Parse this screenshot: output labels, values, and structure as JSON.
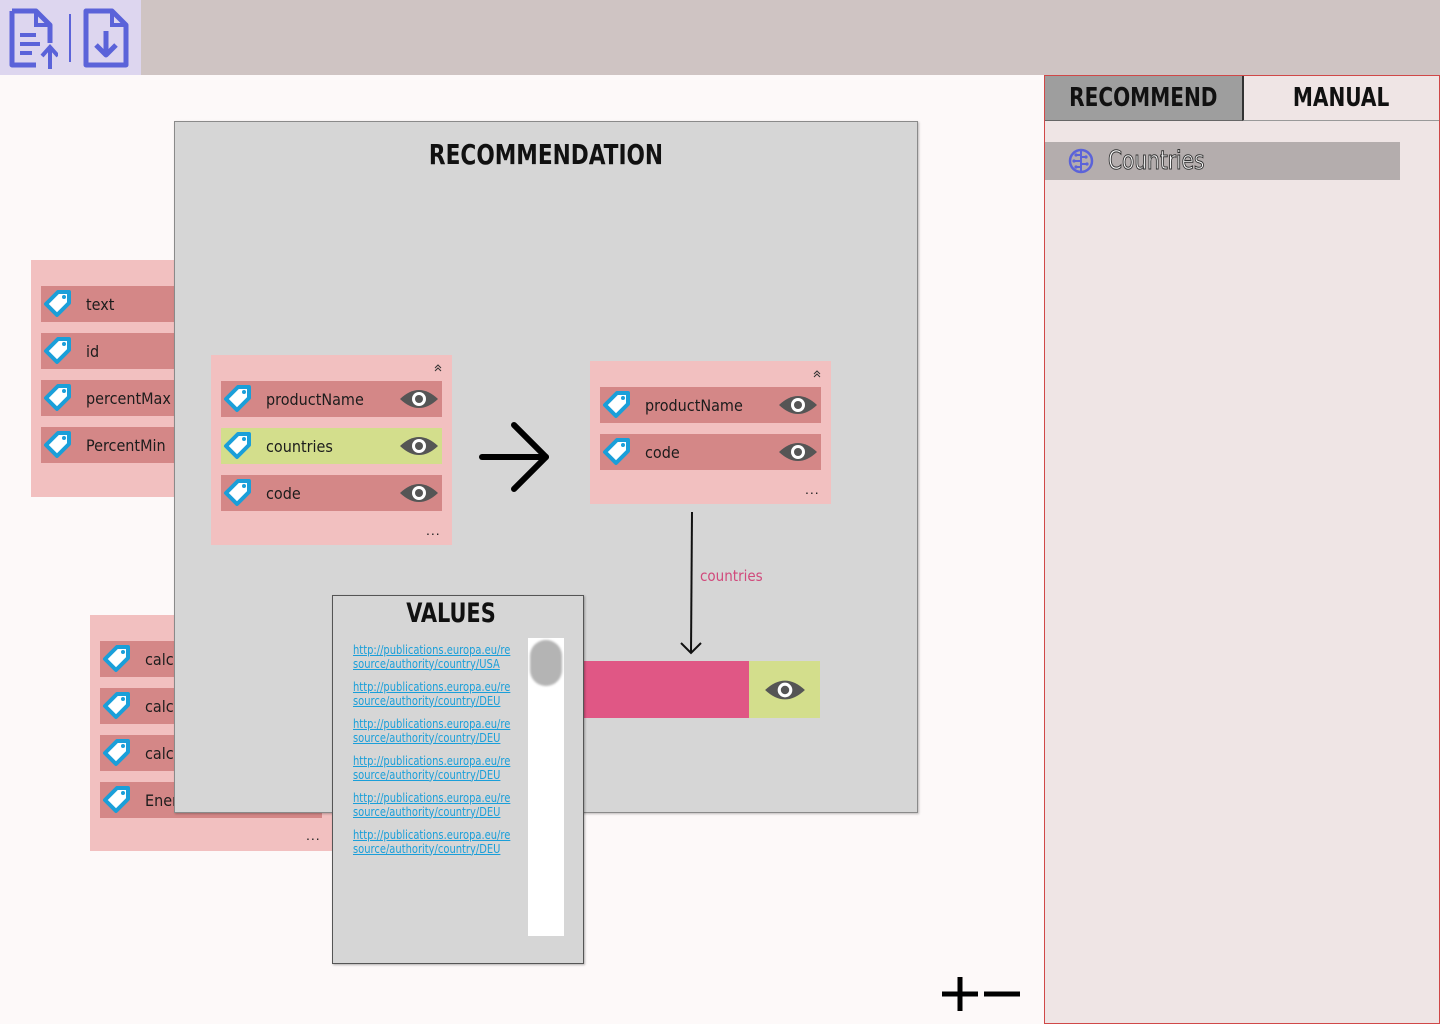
{
  "colors": {
    "topbar": "#cfc4c3",
    "toolbar_group": "#ddd6ef",
    "icon_accent": "#5b63d9",
    "card_bg": "#f2c0c0",
    "row_bg": "#d48787",
    "row_highlight": "#d3de8c",
    "tag_blue": "#1a9fd9",
    "eye_dark": "#555555",
    "panel_gray": "#d6d6d6",
    "target_pink": "#e05785",
    "link_blue": "#1a9fd9",
    "sidebar_bg": "#efe5e5",
    "sidebar_border": "#d04848"
  },
  "toolbar": {
    "upload_icon": "file-upload-icon",
    "download_icon": "file-download-icon"
  },
  "left_card_top": {
    "rows": [
      {
        "label": "text",
        "icon": "tag-icon"
      },
      {
        "label": "id",
        "icon": "tag-icon"
      },
      {
        "label": "percentMax",
        "icon": "tag-icon"
      },
      {
        "label": "PercentMin",
        "icon": "tag-icon"
      }
    ]
  },
  "left_card_bottom": {
    "rows": [
      {
        "label": "calci",
        "icon": "tag-icon"
      },
      {
        "label": "calci",
        "icon": "tag-icon"
      },
      {
        "label": "calci",
        "icon": "tag-icon"
      },
      {
        "label": "Ener",
        "icon": "tag-icon"
      }
    ],
    "more": "..."
  },
  "recommendation": {
    "title": "RECOMMENDATION",
    "source_card": {
      "rows": [
        {
          "label": "productName",
          "highlighted": false
        },
        {
          "label": "countries",
          "highlighted": true
        },
        {
          "label": "code",
          "highlighted": false
        }
      ],
      "more": "..."
    },
    "target_card": {
      "rows": [
        {
          "label": "productName"
        },
        {
          "label": "code"
        }
      ],
      "more": "..."
    },
    "arrow_icon": "arrow-right-icon",
    "flow_label": "countries"
  },
  "values": {
    "title": "VALUES",
    "items": [
      "http://publications.europa.eu/resource/authority/country/USA",
      "http://publications.europa.eu/resource/authority/country/DEU",
      "http://publications.europa.eu/resource/authority/country/DEU",
      "http://publications.europa.eu/resource/authority/country/DEU",
      "http://publications.europa.eu/resource/authority/country/DEU",
      "http://publications.europa.eu/resource/authority/country/DEU"
    ]
  },
  "sidebar": {
    "tabs": [
      {
        "label": "RECOMMEND",
        "active": true
      },
      {
        "label": "MANUAL",
        "active": false
      }
    ],
    "suggestions": [
      {
        "label": "Countries",
        "icon": "brain-icon"
      }
    ]
  },
  "zoom": {
    "in_icon": "plus-icon",
    "out_icon": "minus-icon"
  }
}
